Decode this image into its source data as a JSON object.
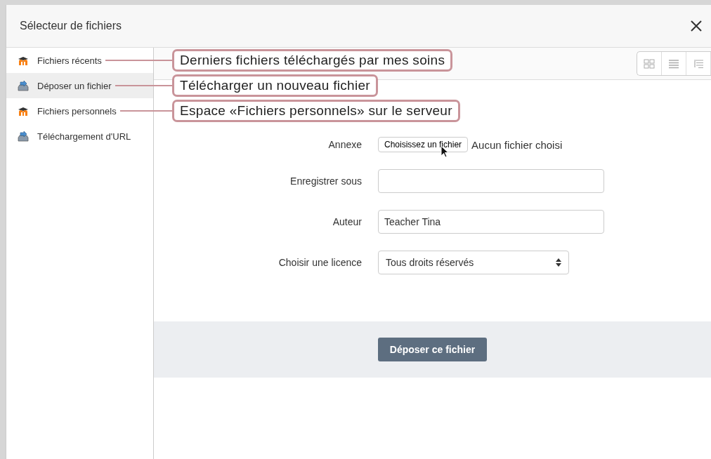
{
  "window": {
    "title": "Sélecteur de fichiers"
  },
  "sidebar": {
    "items": [
      {
        "label": "Fichiers récents",
        "kind": "moodle",
        "selected": false,
        "callout": "Derniers fichiers téléchargés par mes soins"
      },
      {
        "label": "Déposer un fichier",
        "kind": "upload",
        "selected": true,
        "callout": "Télécharger un nouveau fichier"
      },
      {
        "label": "Fichiers personnels",
        "kind": "moodle",
        "selected": false,
        "callout": "Espace «Fichiers personnels» sur le serveur"
      },
      {
        "label": "Téléchargement d'URL",
        "kind": "upload",
        "selected": false
      }
    ]
  },
  "form": {
    "attachment": {
      "label": "Annexe",
      "button": "Choisissez un fichier",
      "status": "Aucun fichier choisi"
    },
    "fields": [
      {
        "kind": "text",
        "label": "Enregistrer sous"
      },
      {
        "kind": "text",
        "label": "Auteur",
        "value": "Teacher Tina"
      },
      {
        "kind": "select",
        "label": "Choisir une licence",
        "value": "Tous droits réservés"
      }
    ],
    "submit": "Déposer ce fichier"
  }
}
